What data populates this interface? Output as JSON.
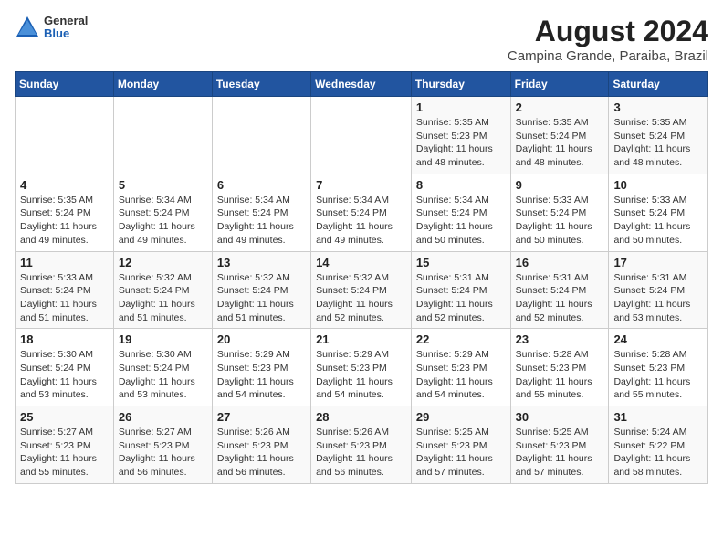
{
  "logo": {
    "general": "General",
    "blue": "Blue"
  },
  "title": {
    "month_year": "August 2024",
    "location": "Campina Grande, Paraiba, Brazil"
  },
  "days_of_week": [
    "Sunday",
    "Monday",
    "Tuesday",
    "Wednesday",
    "Thursday",
    "Friday",
    "Saturday"
  ],
  "weeks": [
    [
      {
        "day": "",
        "info": ""
      },
      {
        "day": "",
        "info": ""
      },
      {
        "day": "",
        "info": ""
      },
      {
        "day": "",
        "info": ""
      },
      {
        "day": "1",
        "info": "Sunrise: 5:35 AM\nSunset: 5:23 PM\nDaylight: 11 hours\nand 48 minutes."
      },
      {
        "day": "2",
        "info": "Sunrise: 5:35 AM\nSunset: 5:24 PM\nDaylight: 11 hours\nand 48 minutes."
      },
      {
        "day": "3",
        "info": "Sunrise: 5:35 AM\nSunset: 5:24 PM\nDaylight: 11 hours\nand 48 minutes."
      }
    ],
    [
      {
        "day": "4",
        "info": "Sunrise: 5:35 AM\nSunset: 5:24 PM\nDaylight: 11 hours\nand 49 minutes."
      },
      {
        "day": "5",
        "info": "Sunrise: 5:34 AM\nSunset: 5:24 PM\nDaylight: 11 hours\nand 49 minutes."
      },
      {
        "day": "6",
        "info": "Sunrise: 5:34 AM\nSunset: 5:24 PM\nDaylight: 11 hours\nand 49 minutes."
      },
      {
        "day": "7",
        "info": "Sunrise: 5:34 AM\nSunset: 5:24 PM\nDaylight: 11 hours\nand 49 minutes."
      },
      {
        "day": "8",
        "info": "Sunrise: 5:34 AM\nSunset: 5:24 PM\nDaylight: 11 hours\nand 50 minutes."
      },
      {
        "day": "9",
        "info": "Sunrise: 5:33 AM\nSunset: 5:24 PM\nDaylight: 11 hours\nand 50 minutes."
      },
      {
        "day": "10",
        "info": "Sunrise: 5:33 AM\nSunset: 5:24 PM\nDaylight: 11 hours\nand 50 minutes."
      }
    ],
    [
      {
        "day": "11",
        "info": "Sunrise: 5:33 AM\nSunset: 5:24 PM\nDaylight: 11 hours\nand 51 minutes."
      },
      {
        "day": "12",
        "info": "Sunrise: 5:32 AM\nSunset: 5:24 PM\nDaylight: 11 hours\nand 51 minutes."
      },
      {
        "day": "13",
        "info": "Sunrise: 5:32 AM\nSunset: 5:24 PM\nDaylight: 11 hours\nand 51 minutes."
      },
      {
        "day": "14",
        "info": "Sunrise: 5:32 AM\nSunset: 5:24 PM\nDaylight: 11 hours\nand 52 minutes."
      },
      {
        "day": "15",
        "info": "Sunrise: 5:31 AM\nSunset: 5:24 PM\nDaylight: 11 hours\nand 52 minutes."
      },
      {
        "day": "16",
        "info": "Sunrise: 5:31 AM\nSunset: 5:24 PM\nDaylight: 11 hours\nand 52 minutes."
      },
      {
        "day": "17",
        "info": "Sunrise: 5:31 AM\nSunset: 5:24 PM\nDaylight: 11 hours\nand 53 minutes."
      }
    ],
    [
      {
        "day": "18",
        "info": "Sunrise: 5:30 AM\nSunset: 5:24 PM\nDaylight: 11 hours\nand 53 minutes."
      },
      {
        "day": "19",
        "info": "Sunrise: 5:30 AM\nSunset: 5:24 PM\nDaylight: 11 hours\nand 53 minutes."
      },
      {
        "day": "20",
        "info": "Sunrise: 5:29 AM\nSunset: 5:23 PM\nDaylight: 11 hours\nand 54 minutes."
      },
      {
        "day": "21",
        "info": "Sunrise: 5:29 AM\nSunset: 5:23 PM\nDaylight: 11 hours\nand 54 minutes."
      },
      {
        "day": "22",
        "info": "Sunrise: 5:29 AM\nSunset: 5:23 PM\nDaylight: 11 hours\nand 54 minutes."
      },
      {
        "day": "23",
        "info": "Sunrise: 5:28 AM\nSunset: 5:23 PM\nDaylight: 11 hours\nand 55 minutes."
      },
      {
        "day": "24",
        "info": "Sunrise: 5:28 AM\nSunset: 5:23 PM\nDaylight: 11 hours\nand 55 minutes."
      }
    ],
    [
      {
        "day": "25",
        "info": "Sunrise: 5:27 AM\nSunset: 5:23 PM\nDaylight: 11 hours\nand 55 minutes."
      },
      {
        "day": "26",
        "info": "Sunrise: 5:27 AM\nSunset: 5:23 PM\nDaylight: 11 hours\nand 56 minutes."
      },
      {
        "day": "27",
        "info": "Sunrise: 5:26 AM\nSunset: 5:23 PM\nDaylight: 11 hours\nand 56 minutes."
      },
      {
        "day": "28",
        "info": "Sunrise: 5:26 AM\nSunset: 5:23 PM\nDaylight: 11 hours\nand 56 minutes."
      },
      {
        "day": "29",
        "info": "Sunrise: 5:25 AM\nSunset: 5:23 PM\nDaylight: 11 hours\nand 57 minutes."
      },
      {
        "day": "30",
        "info": "Sunrise: 5:25 AM\nSunset: 5:23 PM\nDaylight: 11 hours\nand 57 minutes."
      },
      {
        "day": "31",
        "info": "Sunrise: 5:24 AM\nSunset: 5:22 PM\nDaylight: 11 hours\nand 58 minutes."
      }
    ]
  ]
}
